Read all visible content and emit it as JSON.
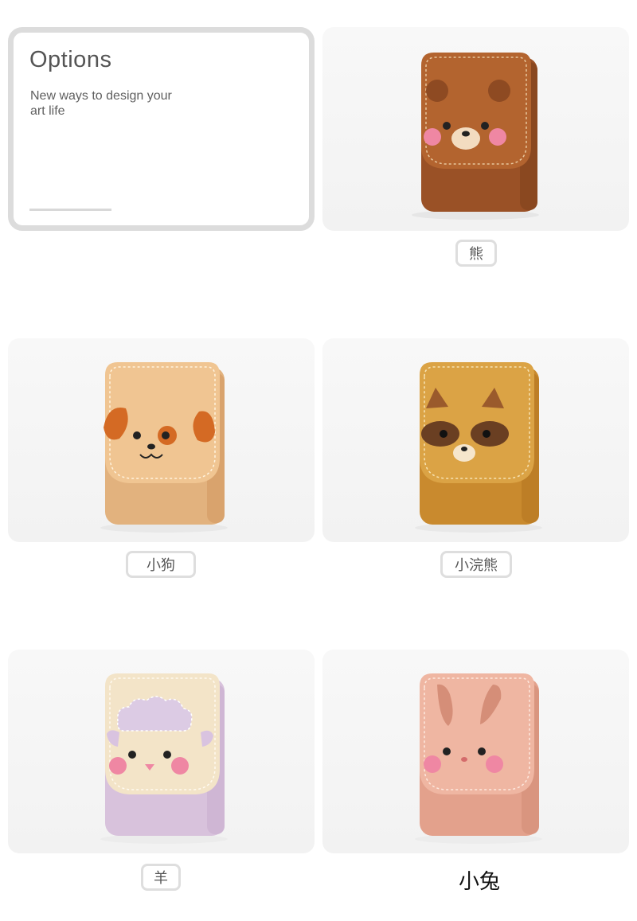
{
  "intro": {
    "title": "Options",
    "subtitle": "New ways to design your art life"
  },
  "options": [
    {
      "label": "熊",
      "icon": "bear-pouch-image",
      "colors": {
        "body": "#a65a2c",
        "flap": "#b8683a"
      }
    },
    {
      "label": "小狗",
      "icon": "dog-pouch-image",
      "colors": {
        "body": "#e9bc8a",
        "flap": "#f3cd9e"
      }
    },
    {
      "label": "小浣熊",
      "icon": "raccoon-pouch-image",
      "colors": {
        "body": "#d49a3a",
        "flap": "#dfa84b"
      }
    },
    {
      "label": "羊",
      "icon": "sheep-pouch-image",
      "colors": {
        "body": "#dcc6e0",
        "flap": "#f3e5cc"
      }
    },
    {
      "label": "小兔",
      "icon": "rabbit-pouch-image",
      "colors": {
        "body": "#e8aa95",
        "flap": "#efb8a3"
      }
    }
  ]
}
